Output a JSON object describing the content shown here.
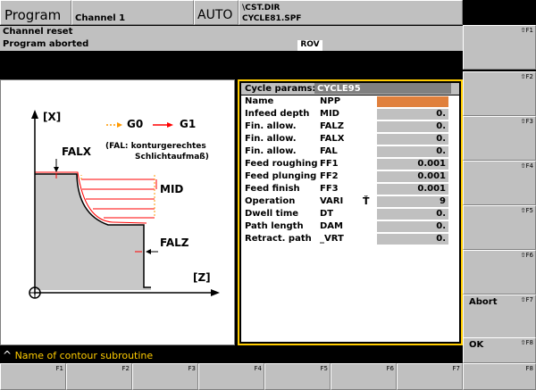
{
  "header": {
    "program": "Program",
    "channel": "Channel 1",
    "mode": "AUTO",
    "path_line1": "\\CST.DIR",
    "path_line2": "CYCLE81.SPF"
  },
  "status": {
    "line1": "Channel reset",
    "line2": "Program aborted",
    "rov": "ROV"
  },
  "diagram": {
    "axis_x": "[X]",
    "axis_z": "[Z]",
    "legend_g0": "G0",
    "legend_g1": "G1",
    "falx": "FALX",
    "falz": "FALZ",
    "mid": "MID",
    "note_line1": "(FAL: konturgerechtes",
    "note_line2": "Schlichtaufmaß)"
  },
  "panel": {
    "title": "Cycle params:",
    "cycle": "CYCLE95",
    "rows": [
      {
        "label": "Name",
        "code": "NPP",
        "value": ""
      },
      {
        "label": "Infeed depth",
        "code": "MID",
        "value": "0."
      },
      {
        "label": "Fin. allow.",
        "code": "FALZ",
        "value": "0."
      },
      {
        "label": "Fin. allow.",
        "code": "FALX",
        "value": "0."
      },
      {
        "label": "Fin. allow.",
        "code": "FAL",
        "value": "0."
      },
      {
        "label": "Feed roughing",
        "code": "FF1",
        "value": "0.001"
      },
      {
        "label": "Feed plunging",
        "code": "FF2",
        "value": "0.001"
      },
      {
        "label": "Feed finish",
        "code": "FF3",
        "value": "0.001"
      },
      {
        "label": "Operation",
        "code": "VARI",
        "value": "9"
      },
      {
        "label": "Dwell time",
        "code": "DT",
        "value": "0."
      },
      {
        "label": "Path length",
        "code": "DAM",
        "value": "0."
      },
      {
        "label": "Retract. path",
        "code": "_VRT",
        "value": "0."
      }
    ]
  },
  "softkeys_right": [
    {
      "fkey": "⇧F1",
      "label": ""
    },
    {
      "fkey": "⇧F2",
      "label": ""
    },
    {
      "fkey": "⇧F3",
      "label": ""
    },
    {
      "fkey": "⇧F4",
      "label": ""
    },
    {
      "fkey": "⇧F5",
      "label": ""
    },
    {
      "fkey": "⇧F6",
      "label": ""
    },
    {
      "fkey": "⇧F7",
      "label": "Abort"
    },
    {
      "fkey": "⇧F8",
      "label": "OK"
    }
  ],
  "hint": "Name of contour subroutine",
  "softkeys_bottom": [
    "F1",
    "F2",
    "F3",
    "F4",
    "F5",
    "F6",
    "F7",
    "F8"
  ],
  "colors": {
    "panel_border": "#ffcc00",
    "name_field": "#e0803c",
    "g0_arrow": "#ff9900",
    "g1_arrow": "#ff0000"
  }
}
